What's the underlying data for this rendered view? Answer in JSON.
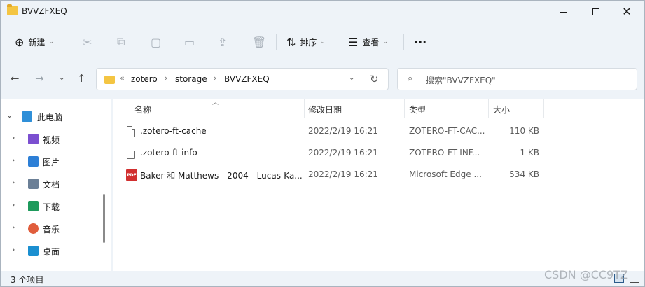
{
  "window": {
    "title": "BVVZFXEQ"
  },
  "commandbar": {
    "new_label": "新建",
    "sort_label": "排序",
    "view_label": "查看",
    "more_label": "···"
  },
  "address": {
    "overflow": "«",
    "crumbs": [
      "zotero",
      "storage",
      "BVVZFXEQ"
    ],
    "separator": "›"
  },
  "search": {
    "placeholder": "搜索\"BVVZFXEQ\""
  },
  "sidebar": {
    "items": [
      {
        "label": "此电脑",
        "icon": "computer-icon",
        "color": "#2f8fd8"
      },
      {
        "label": "视频",
        "icon": "video-icon",
        "color": "#7b4fd0"
      },
      {
        "label": "图片",
        "icon": "pictures-icon",
        "color": "#2d7fd6"
      },
      {
        "label": "文档",
        "icon": "documents-icon",
        "color": "#6b7f96"
      },
      {
        "label": "下载",
        "icon": "downloads-icon",
        "color": "#1e9a5c"
      },
      {
        "label": "音乐",
        "icon": "music-icon",
        "color": "#e05d3c"
      },
      {
        "label": "桌面",
        "icon": "desktop-icon",
        "color": "#1b8fd0"
      }
    ]
  },
  "columns": {
    "name": "名称",
    "modified": "修改日期",
    "type": "类型",
    "size": "大小"
  },
  "files": [
    {
      "name": ".zotero-ft-cache",
      "modified": "2022/2/19 16:21",
      "type": "ZOTERO-FT-CAC...",
      "size": "110 KB",
      "icon": "file-icon"
    },
    {
      "name": ".zotero-ft-info",
      "modified": "2022/2/19 16:21",
      "type": "ZOTERO-FT-INF...",
      "size": "1 KB",
      "icon": "file-icon"
    },
    {
      "name": "Baker 和 Matthews - 2004 - Lucas-Ka...",
      "modified": "2022/2/19 16:21",
      "type": "Microsoft Edge ...",
      "size": "534 KB",
      "icon": "pdf-icon",
      "icon_text": "PDF"
    }
  ],
  "status": {
    "count": "3 个项目"
  },
  "watermark": "CSDN @CC9TZ"
}
